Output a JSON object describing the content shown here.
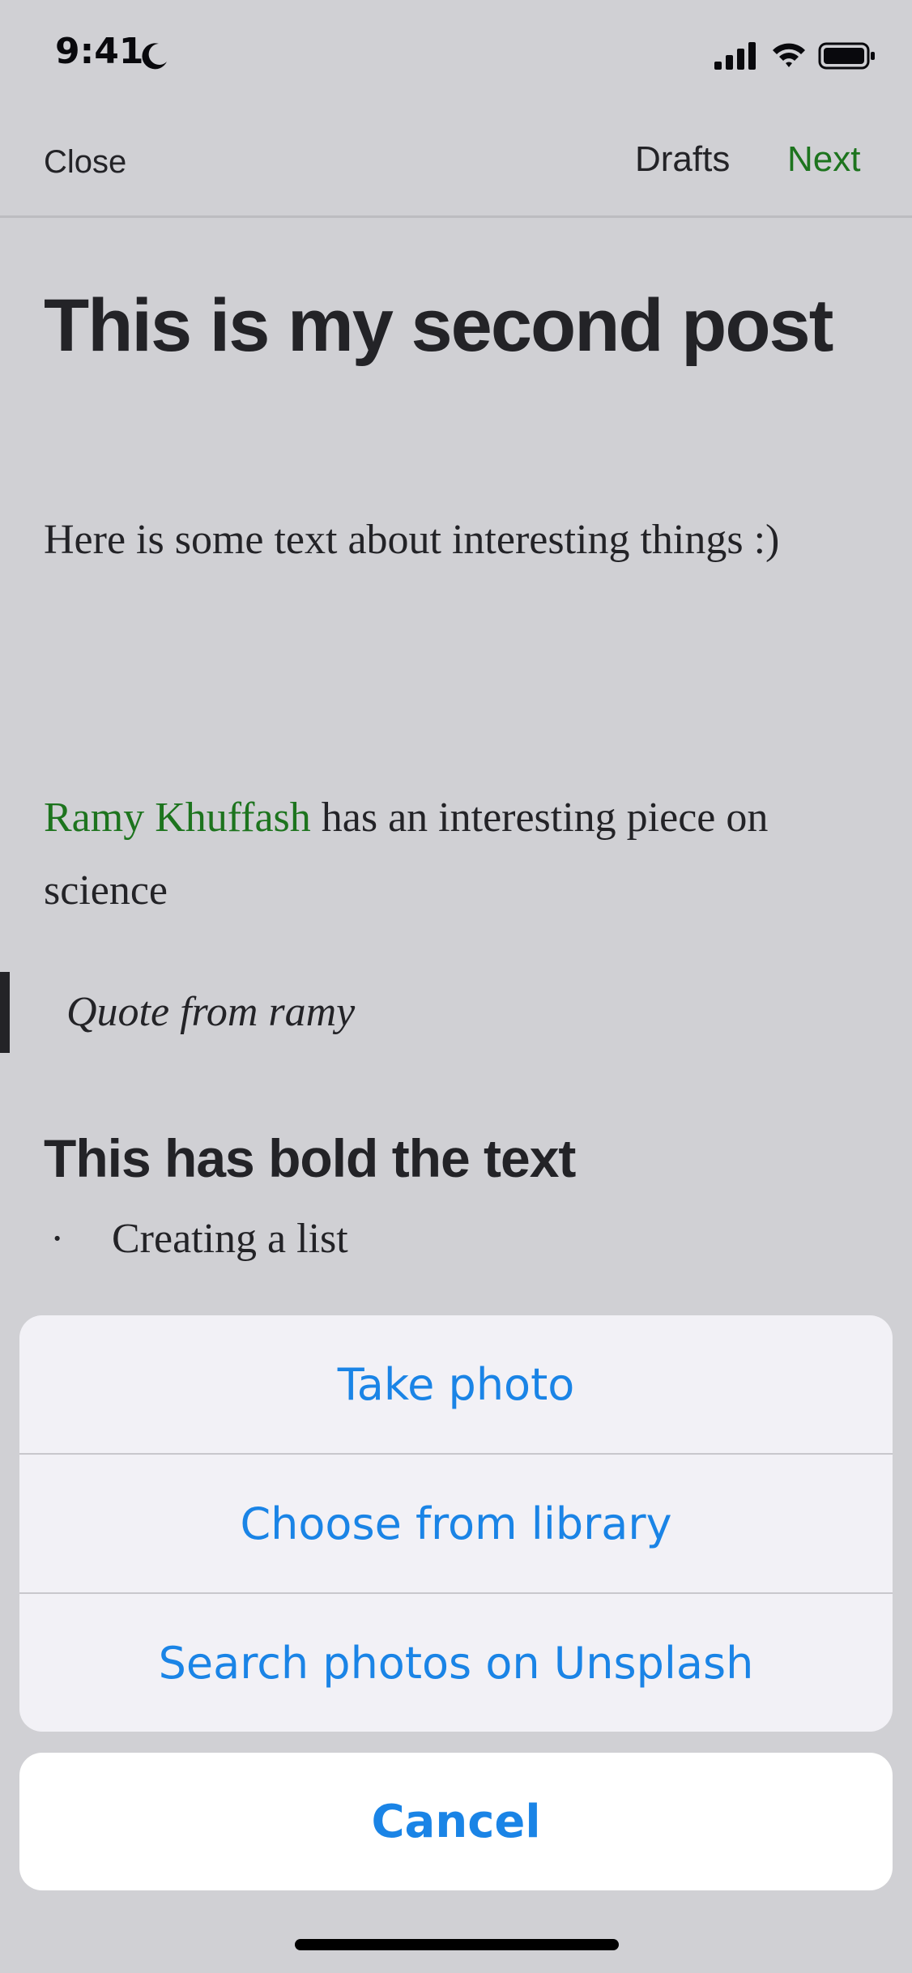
{
  "status_bar": {
    "time": "9:41",
    "icons": [
      "moon-icon",
      "signal-icon",
      "wifi-icon",
      "battery-icon"
    ]
  },
  "nav": {
    "close_label": "Close",
    "drafts_label": "Drafts",
    "next_label": "Next"
  },
  "post": {
    "title": "This is my second post",
    "paragraph1": "Here is some text about interesting things :)",
    "mention": "Ramy Khuffash",
    "paragraph2_rest": " has an interesting piece on science",
    "quote": "Quote from ramy",
    "bold_heading": "This has bold the text",
    "list_bullet": "·",
    "list_item": "Creating a list"
  },
  "action_sheet": {
    "take_photo": "Take photo",
    "choose_library": "Choose from library",
    "search_unsplash": "Search photos on Unsplash",
    "cancel": "Cancel"
  },
  "colors": {
    "accent_green": "#1a8917",
    "action_blue": "#1a84e6"
  }
}
